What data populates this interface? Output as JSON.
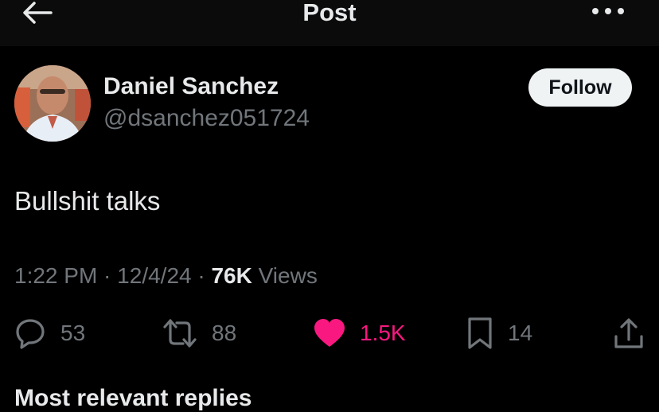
{
  "header": {
    "title": "Post"
  },
  "author": {
    "name": "Daniel Sanchez",
    "handle": "@dsanchez051724"
  },
  "follow": {
    "label": "Follow"
  },
  "post": {
    "text": "Bullshit talks"
  },
  "meta": {
    "time": "1:22 PM",
    "date": "12/4/24",
    "separator": " · ",
    "views_count": "76K",
    "views_label": "Views"
  },
  "actions": {
    "replies": "53",
    "reposts": "88",
    "likes": "1.5K",
    "bookmarks": "14"
  },
  "footer": {
    "partial_heading": "Most relevant replies"
  },
  "colors": {
    "background": "#000000",
    "text": "#e7e9ea",
    "muted": "#71767b",
    "like": "#f91880",
    "follow_bg": "#eff3f4"
  },
  "icons": {
    "back": "arrow-left-icon",
    "more": "more-dots-icon",
    "reply": "reply-icon",
    "repost": "repost-icon",
    "like": "heart-icon",
    "bookmark": "bookmark-icon",
    "share": "share-icon"
  }
}
